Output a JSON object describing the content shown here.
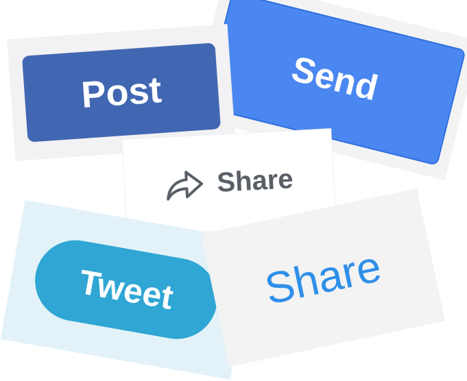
{
  "buttons": {
    "post": {
      "label": "Post",
      "color": "#4267b2"
    },
    "send": {
      "label": "Send",
      "color": "#4a87f0"
    },
    "share_icon": {
      "label": "Share",
      "icon": "share-arrow-icon",
      "color": "#5a5f66"
    },
    "tweet": {
      "label": "Tweet",
      "color": "#2fa6d4"
    },
    "share_plain": {
      "label": "Share",
      "color": "#2f8fe8"
    }
  }
}
